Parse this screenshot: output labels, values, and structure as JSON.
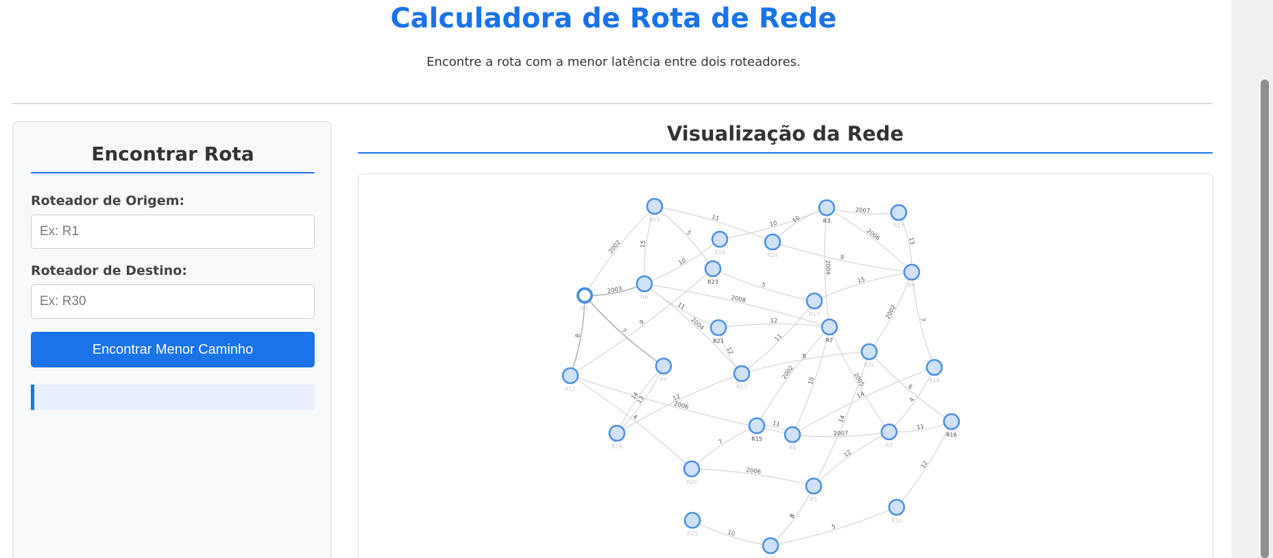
{
  "header": {
    "title": "Calculadora de Rota de Rede",
    "subtitle": "Encontre a rota com a menor latência entre dois roteadores."
  },
  "route_panel": {
    "title": "Encontrar Rota",
    "origin_label": "Roteador de Origem:",
    "origin_placeholder": "Ex: R1",
    "origin_value": "",
    "destination_label": "Roteador de Destino:",
    "destination_placeholder": "Ex: R30",
    "destination_value": "",
    "button_label": "Encontrar Menor Caminho",
    "result_text": ""
  },
  "visualization": {
    "title": "Visualização da Rede",
    "node_color": "#cfe2fa",
    "node_border_color": "#4a90e2",
    "accent_color": "#1a73e8",
    "nodes": [
      {
        "id": "n01",
        "label": "R11",
        "faded": true
      },
      {
        "id": "n02",
        "label": "R3",
        "faded": false
      },
      {
        "id": "n03",
        "label": "R27",
        "faded": true
      },
      {
        "id": "n04",
        "label": "R19",
        "faded": true
      },
      {
        "id": "n05",
        "label": "R24",
        "faded": true
      },
      {
        "id": "n06",
        "label": "R23",
        "faded": false
      },
      {
        "id": "n07",
        "label": "R9",
        "faded": true
      },
      {
        "id": "n08",
        "label": "R6",
        "faded": true
      },
      {
        "id": "n09",
        "label": "R1",
        "faded": true,
        "selected": true
      },
      {
        "id": "n10",
        "label": "R17",
        "faded": true
      },
      {
        "id": "n11",
        "label": "R21",
        "faded": false
      },
      {
        "id": "n12",
        "label": "R7",
        "faded": false
      },
      {
        "id": "n13",
        "label": "R22",
        "faded": true
      },
      {
        "id": "n14",
        "label": "R8",
        "faded": true
      },
      {
        "id": "n15",
        "label": "R13",
        "faded": true
      },
      {
        "id": "n16",
        "label": "R18",
        "faded": true
      },
      {
        "id": "n17",
        "label": "R12",
        "faded": true
      },
      {
        "id": "n18",
        "label": "R15",
        "faded": false
      },
      {
        "id": "n19",
        "label": "R4",
        "faded": true
      },
      {
        "id": "n20",
        "label": "R2",
        "faded": true
      },
      {
        "id": "n21",
        "label": "R16",
        "faded": false
      },
      {
        "id": "n22",
        "label": "R26",
        "faded": true
      },
      {
        "id": "n23",
        "label": "R20",
        "faded": true
      },
      {
        "id": "n24",
        "label": "R5",
        "faded": true
      },
      {
        "id": "n25",
        "label": "R25",
        "faded": true
      },
      {
        "id": "n26",
        "label": "R30",
        "faded": true
      },
      {
        "id": "n27",
        "label": "R10",
        "faded": true
      }
    ],
    "edges": [
      {
        "from": "n01",
        "to": "n09",
        "latency": "2002"
      },
      {
        "from": "n01",
        "to": "n05",
        "latency": "11"
      },
      {
        "from": "n01",
        "to": "n08",
        "latency": "15"
      },
      {
        "from": "n01",
        "to": "n06",
        "latency": "5"
      },
      {
        "from": "n04",
        "to": "n02",
        "latency": "10"
      },
      {
        "from": "n04",
        "to": "n08",
        "latency": "10"
      },
      {
        "from": "n02",
        "to": "n03",
        "latency": "2007"
      },
      {
        "from": "n02",
        "to": "n07",
        "latency": "2006"
      },
      {
        "from": "n02",
        "to": "n12",
        "latency": "2004"
      },
      {
        "from": "n05",
        "to": "n02",
        "latency": "10"
      },
      {
        "from": "n05",
        "to": "n07",
        "latency": "9"
      },
      {
        "from": "n03",
        "to": "n07",
        "latency": "13"
      },
      {
        "from": "n07",
        "to": "n10",
        "latency": "15"
      },
      {
        "from": "n07",
        "to": "n13",
        "latency": "2002"
      },
      {
        "from": "n07",
        "to": "n16",
        "latency": "7"
      },
      {
        "from": "n06",
        "to": "n17",
        "latency": "9"
      },
      {
        "from": "n06",
        "to": "n10",
        "latency": "5"
      },
      {
        "from": "n08",
        "to": "n12",
        "latency": "2008"
      },
      {
        "from": "n08",
        "to": "n11",
        "latency": "11"
      },
      {
        "from": "n08",
        "to": "n15",
        "latency": "2004"
      },
      {
        "from": "n09",
        "to": "n14",
        "latency": "7"
      },
      {
        "from": "n09",
        "to": "n17",
        "latency": "8"
      },
      {
        "from": "n09",
        "to": "n08",
        "latency": "2003"
      },
      {
        "from": "n11",
        "to": "n12",
        "latency": "12"
      },
      {
        "from": "n11",
        "to": "n15",
        "latency": "12"
      },
      {
        "from": "n10",
        "to": "n15",
        "latency": "11"
      },
      {
        "from": "n12",
        "to": "n18",
        "latency": "2002"
      },
      {
        "from": "n12",
        "to": "n19",
        "latency": "10"
      },
      {
        "from": "n12",
        "to": "n20",
        "latency": "2005"
      },
      {
        "from": "n15",
        "to": "n13",
        "latency": "8"
      },
      {
        "from": "n13",
        "to": "n21",
        "latency": "6"
      },
      {
        "from": "n13",
        "to": "n24",
        "latency": "14"
      },
      {
        "from": "n17",
        "to": "n19",
        "latency": "2006"
      },
      {
        "from": "n17",
        "to": "n23",
        "latency": "4"
      },
      {
        "from": "n15",
        "to": "n22",
        "latency": "12"
      },
      {
        "from": "n14",
        "to": "n22",
        "latency": "13"
      },
      {
        "from": "n14",
        "to": "n22",
        "latency": "14"
      },
      {
        "from": "n18",
        "to": "n19",
        "latency": "11"
      },
      {
        "from": "n19",
        "to": "n20",
        "latency": "2007"
      },
      {
        "from": "n16",
        "to": "n20",
        "latency": "4"
      },
      {
        "from": "n18",
        "to": "n23",
        "latency": "7"
      },
      {
        "from": "n19",
        "to": "n16",
        "latency": "14"
      },
      {
        "from": "n20",
        "to": "n21",
        "latency": "11"
      },
      {
        "from": "n23",
        "to": "n24",
        "latency": "2006"
      },
      {
        "from": "n20",
        "to": "n24",
        "latency": "12"
      },
      {
        "from": "n21",
        "to": "n27",
        "latency": "12"
      },
      {
        "from": "n25",
        "to": "n26",
        "latency": "10"
      },
      {
        "from": "n24",
        "to": "n26",
        "latency": "5"
      },
      {
        "from": "n26",
        "to": "n27",
        "latency": "5"
      },
      {
        "from": "n24",
        "to": "n26",
        "latency": "8"
      }
    ]
  }
}
